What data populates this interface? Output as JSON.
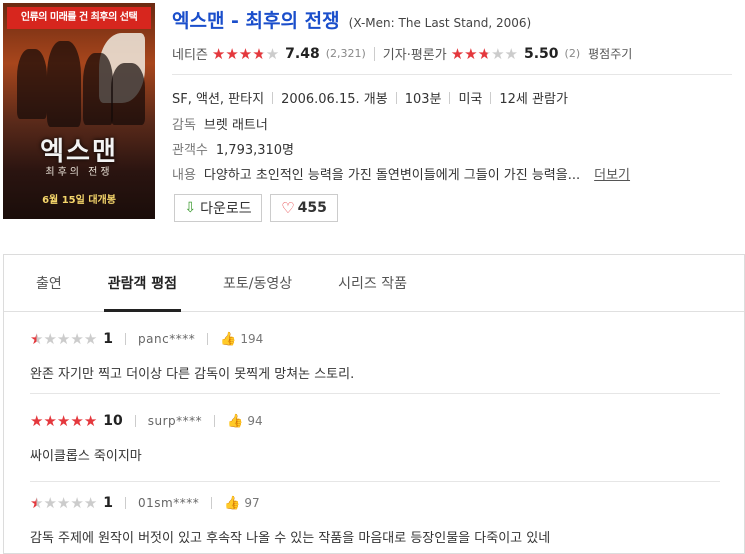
{
  "movie": {
    "title_ko": "엑스맨 - 최후의 전쟁",
    "title_en": "(X-Men: The Last Stand, 2006)",
    "poster": {
      "tagline": "인류의 미래를 건 최후의 선택",
      "title": "엑스맨",
      "subtitle": "최후의 전쟁",
      "release": "6월 15일 대개봉"
    }
  },
  "ratings": {
    "netizen_label": "네티즌",
    "netizen_score": "7.48",
    "netizen_count": "(2,321)",
    "netizen_stars": 3.74,
    "critic_label": "기자·평론가",
    "critic_score": "5.50",
    "critic_count": "(2)",
    "critic_stars": 2.75,
    "write_label": "평점주기"
  },
  "info": {
    "genre": "SF, 액션, 판타지",
    "release_date": "2006.06.15. 개봉",
    "runtime": "103분",
    "country": "미국",
    "age": "12세 관람가",
    "director_label": "감독",
    "director": "브렛 래트너",
    "audience_label": "관객수",
    "audience": "1,793,310명",
    "plot_label": "내용",
    "plot": "다양하고 초인적인 능력을 가진 돌연변이들에게 그들이 가진 능력을...",
    "more_label": "더보기"
  },
  "buttons": {
    "download": "다운로드",
    "likes": "455"
  },
  "tabs": [
    "출연",
    "관람객 평점",
    "포토/동영상",
    "시리즈 작품"
  ],
  "active_tab": 1,
  "reviews": [
    {
      "score": "1",
      "stars": 0.5,
      "user": "panc****",
      "likes": "194",
      "text": "완존 자기만 찍고 더이상 다른 감독이 못찍게 망쳐논 스토리."
    },
    {
      "score": "10",
      "stars": 5,
      "user": "surp****",
      "likes": "94",
      "text": "싸이클롭스 죽이지마"
    },
    {
      "score": "1",
      "stars": 0.5,
      "user": "01sm****",
      "likes": "97",
      "text": "감독 주제에 원작이 버젓이 있고 후속작 나올 수 있는 작품을 마음대로 등장인물을 다죽이고 있네"
    }
  ],
  "colors": {
    "accent": "#1a4ecb",
    "star": "#e4383d",
    "download": "#3a9a2e"
  }
}
